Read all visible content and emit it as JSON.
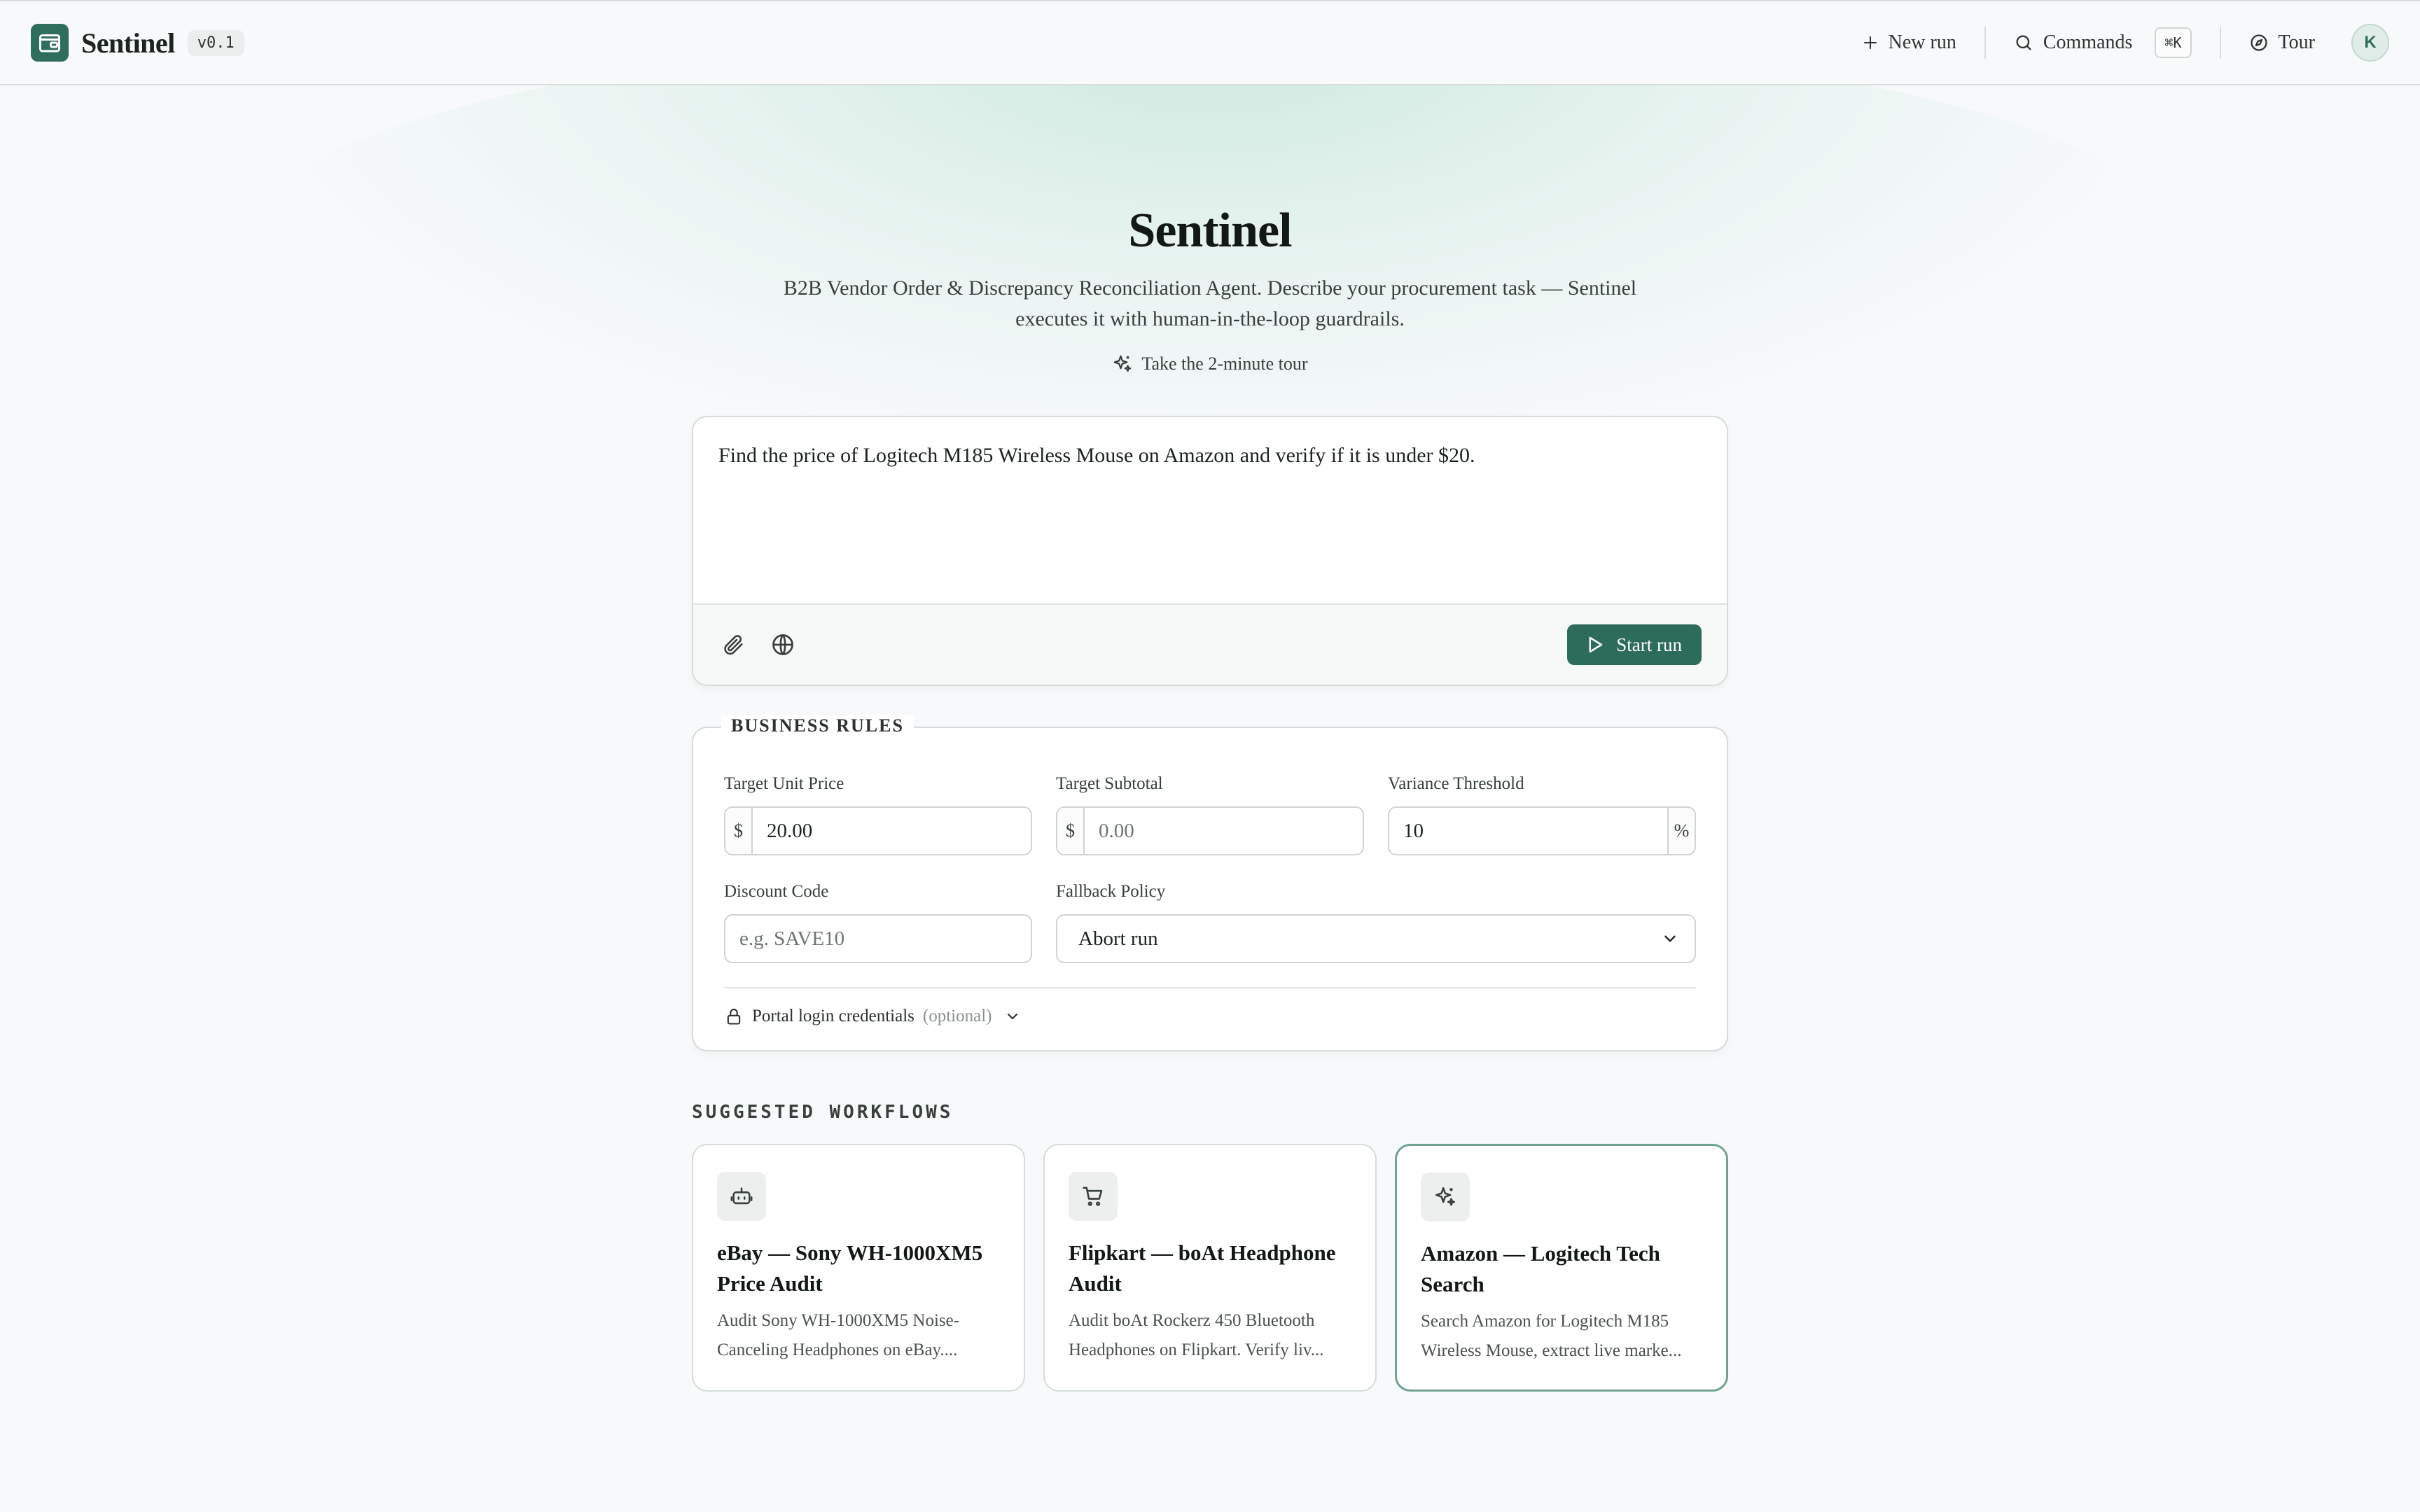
{
  "header": {
    "brand": "Sentinel",
    "version": "v0.1",
    "new_run_label": "New run",
    "commands_label": "Commands",
    "commands_shortcut": "⌘K",
    "tour_label": "Tour",
    "avatar_initial": "K"
  },
  "hero": {
    "title": "Sentinel",
    "subtitle": "B2B Vendor Order & Discrepancy Reconciliation Agent. Describe your procurement task — Sentinel executes it with human-in-the-loop guardrails.",
    "tour_link": "Take the 2-minute tour"
  },
  "prompt": {
    "text": "Find the price of Logitech M185 Wireless Mouse on Amazon and verify if it is under $20.",
    "start_label": "Start run"
  },
  "rules": {
    "legend": "BUSINESS RULES",
    "target_unit_price": {
      "label": "Target Unit Price",
      "prefix": "$",
      "value": "20.00"
    },
    "target_subtotal": {
      "label": "Target Subtotal",
      "prefix": "$",
      "placeholder": "0.00"
    },
    "variance_threshold": {
      "label": "Variance Threshold",
      "value": "10",
      "suffix": "%"
    },
    "discount_code": {
      "label": "Discount Code",
      "placeholder": "e.g. SAVE10"
    },
    "fallback_policy": {
      "label": "Fallback Policy",
      "value": "Abort run"
    },
    "credentials": {
      "label": "Portal login credentials",
      "optional": "(optional)"
    }
  },
  "workflows": {
    "section_title": "SUGGESTED WORKFLOWS",
    "items": [
      {
        "icon": "robot-icon",
        "title": "eBay — Sony WH-1000XM5 Price Audit",
        "description": "Audit Sony WH-1000XM5 Noise-Canceling Headphones on eBay...."
      },
      {
        "icon": "cart-icon",
        "title": "Flipkart — boAt Headphone Audit",
        "description": "Audit boAt Rockerz 450 Bluetooth Headphones on Flipkart. Verify liv..."
      },
      {
        "icon": "sparkles-icon",
        "title": "Amazon — Logitech Tech Search",
        "description": "Search Amazon for Logitech M185 Wireless Mouse, extract live marke..."
      }
    ]
  },
  "colors": {
    "accent": "#2d6b5b",
    "active_border": "#6fa394",
    "background": "#f8f9fb"
  }
}
